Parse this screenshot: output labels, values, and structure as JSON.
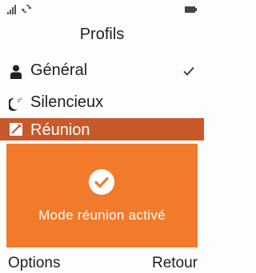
{
  "status_bar": {
    "icons": [
      "signal-icon",
      "sync-icon",
      "battery-icon"
    ]
  },
  "header": {
    "title": "Profils"
  },
  "profiles": [
    {
      "label": "Général",
      "icon": "person-icon",
      "selected": true
    },
    {
      "label": "Silencieux",
      "icon": "moon-sleep-icon",
      "selected": false
    },
    {
      "label": "Réunion",
      "icon": "meeting-icon",
      "selected": false,
      "highlighted": true
    }
  ],
  "popup": {
    "icon": "check-circle-icon",
    "message": "Mode réunion activé"
  },
  "softkeys": {
    "left": "Options",
    "right": "Retour"
  },
  "colors": {
    "highlight": "#c8592a",
    "popup_background": "#f27a2b",
    "text": "#1f1f1f"
  }
}
